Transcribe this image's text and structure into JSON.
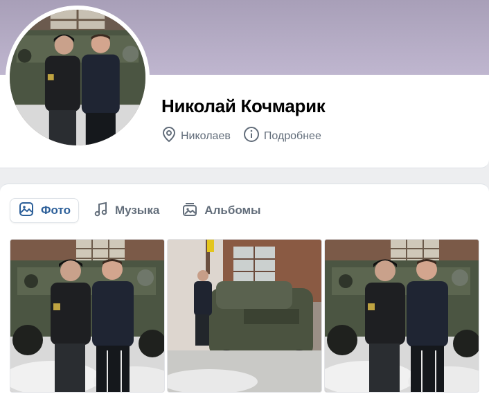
{
  "profile": {
    "name": "Николай Кочмарик",
    "location": "Николаев",
    "details_link": "Подробнее"
  },
  "icons": {
    "location": "location-pin-icon",
    "info": "info-circle-icon",
    "photo": "photo-icon",
    "music": "music-note-icon",
    "albums": "album-stack-icon"
  },
  "tabs": [
    {
      "label": "Фото",
      "active": true
    },
    {
      "label": "Музыка",
      "active": false
    },
    {
      "label": "Альбомы",
      "active": false
    }
  ],
  "colors": {
    "cover": "#b2a9c2",
    "accent": "#2c5f99",
    "muted_text": "#626d7a",
    "page_bg": "#edeef0"
  }
}
